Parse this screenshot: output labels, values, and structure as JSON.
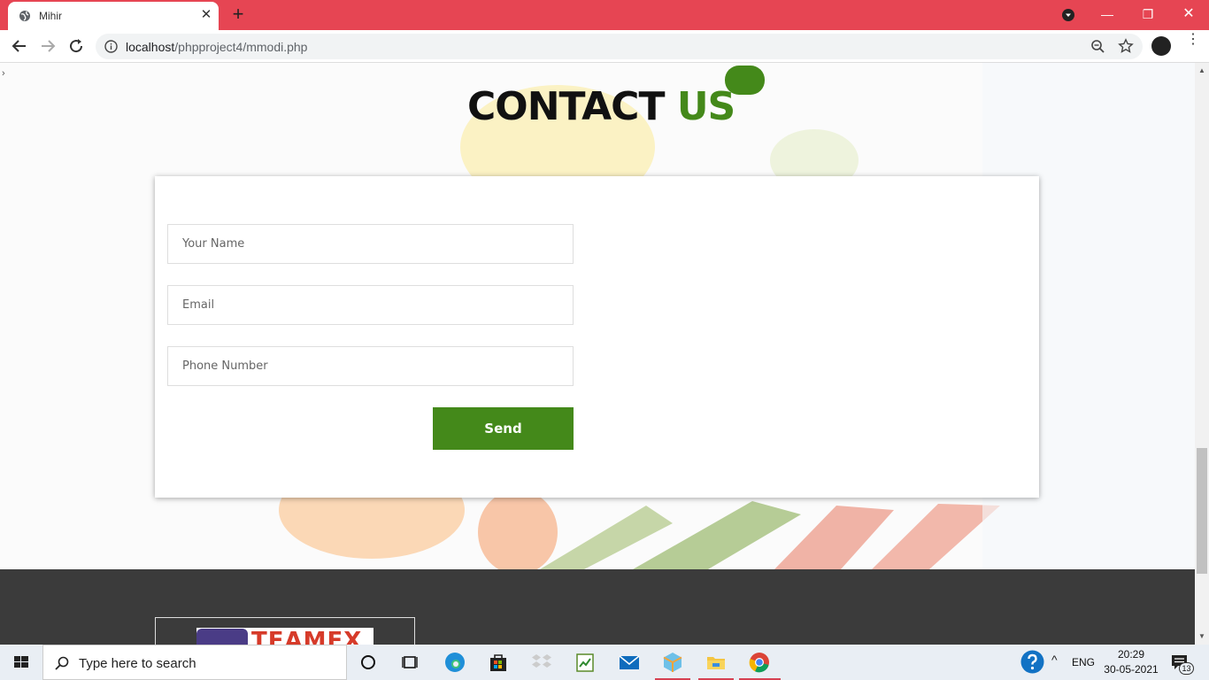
{
  "browser": {
    "tab_title": "Mihir",
    "url_host": "localhost",
    "url_path": "/phpproject4/mmodi.php"
  },
  "page": {
    "collapse_marker": "›",
    "heading_part1": "CONTACT",
    "heading_part2": "US",
    "form": {
      "name_placeholder": "Your Name",
      "email_placeholder": "Email",
      "phone_placeholder": "Phone Number",
      "send_label": "Send"
    },
    "footer_logo_text": "TEAMEX"
  },
  "taskbar": {
    "search_placeholder": "Type here to search",
    "language": "ENG",
    "time": "20:29",
    "date": "30-05-2021",
    "notification_count": "13"
  },
  "colors": {
    "accent_green": "#44891a",
    "chrome_red": "#e64553",
    "footer_dark": "#3b3b3b"
  }
}
